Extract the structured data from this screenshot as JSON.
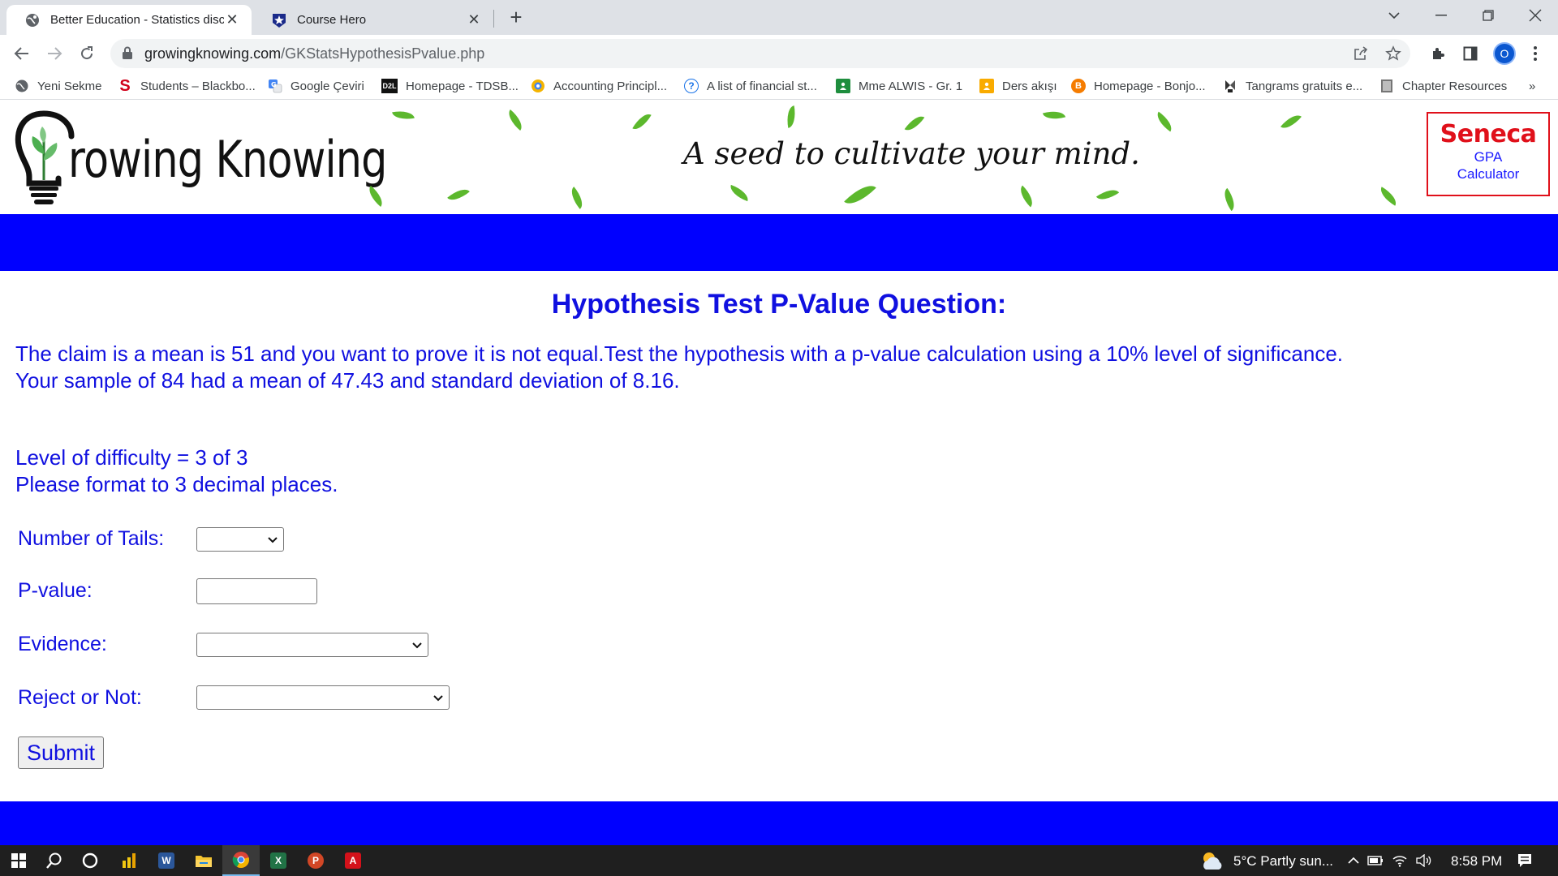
{
  "browser": {
    "tabs": [
      {
        "title": "Better Education - Statistics disco",
        "active": true
      },
      {
        "title": "Course Hero",
        "active": false
      }
    ],
    "url_host": "growingknowing.com",
    "url_path": "/GKStatsHypothesisPvalue.php",
    "profile_initial": "O",
    "bookmarks": [
      {
        "label": "Yeni Sekme",
        "icon": "globe-icon"
      },
      {
        "label": "Students – Blackbo...",
        "icon": "blackboard-icon"
      },
      {
        "label": "Google Çeviri",
        "icon": "translate-icon"
      },
      {
        "label": "Homepage - TDSB...",
        "icon": "d2l-icon"
      },
      {
        "label": "Accounting Principl...",
        "icon": "accounting-icon"
      },
      {
        "label": "A list of financial st...",
        "icon": "help-icon"
      },
      {
        "label": "Mme ALWIS - Gr. 1",
        "icon": "classroom-icon"
      },
      {
        "label": "Ders akışı",
        "icon": "classroom-icon"
      },
      {
        "label": "Homepage - Bonjo...",
        "icon": "bonjour-icon"
      },
      {
        "label": "Tangrams gratuits e...",
        "icon": "tangram-icon"
      },
      {
        "label": "Chapter Resources",
        "icon": "book-icon"
      }
    ],
    "bookmarks_more": "»"
  },
  "site": {
    "logo_text": "rowing Knowing",
    "tagline": "A seed to cultivate your mind.",
    "seneca": {
      "title": "Seneca",
      "line1": "GPA",
      "line2": "Calculator"
    }
  },
  "question": {
    "title": "Hypothesis Test P-Value Question:",
    "line1": "The claim is a mean is 51 and you want to prove it is not equal.Test the hypothesis with a p-value calculation using a 10% level of significance.",
    "line2": "Your sample of 84 had a mean of 47.43 and standard deviation of 8.16.",
    "difficulty": "Level of difficulty = 3 of 3",
    "format": "Please format to 3 decimal places."
  },
  "form": {
    "tails_label": "Number of Tails:",
    "tails_value": "",
    "pvalue_label": "P-value:",
    "pvalue_value": "",
    "evidence_label": "Evidence:",
    "evidence_value": "",
    "reject_label": "Reject or Not:",
    "reject_value": "",
    "submit_label": "Submit"
  },
  "taskbar": {
    "weather": "5°C  Partly sun...",
    "time": "8:58 PM"
  },
  "colors": {
    "accent_blue": "#0000ff",
    "text_blue": "#1010e0",
    "seneca_red": "#e0101a",
    "leaf_green": "#5cb82d"
  }
}
